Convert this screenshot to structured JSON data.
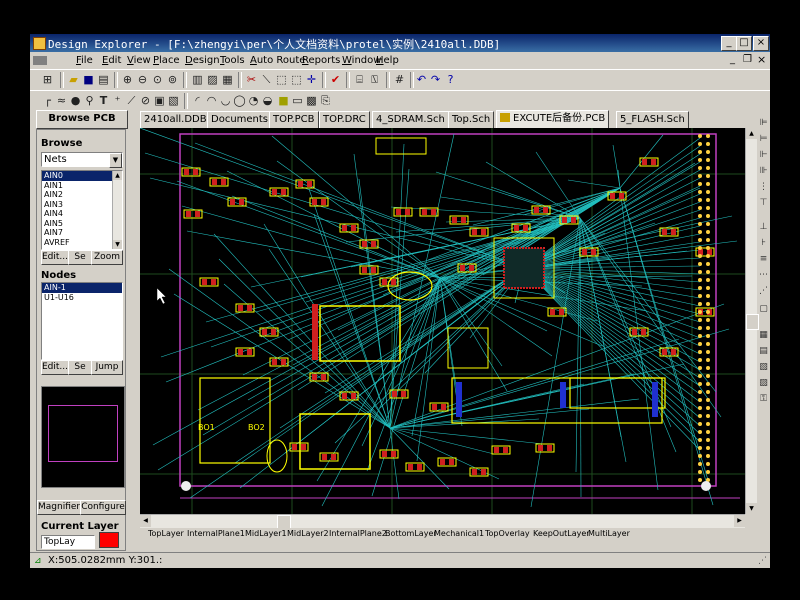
{
  "window": {
    "title": "Design Explorer - [F:\\zhengyi\\per\\个人文档资料\\protel\\实例\\2410all.DDB]",
    "controls": {
      "minimize": "_",
      "maximize": "□",
      "close": "×"
    }
  },
  "menubar": [
    "File",
    "Edit",
    "View",
    "Place",
    "Design",
    "Tools",
    "Auto Route",
    "Reports",
    "Window",
    "Help"
  ],
  "panel": {
    "tab": "Browse PCB",
    "browse_label": "Browse",
    "browse_select": "Nets",
    "nets": [
      "AIN0",
      "AIN1",
      "AIN2",
      "AIN3",
      "AIN4",
      "AIN5",
      "AIN7",
      "AVREF"
    ],
    "nets_selected": "AIN0",
    "net_buttons": [
      "Edit...",
      "Se",
      "Zoom"
    ],
    "nodes_label": "Nodes",
    "nodes": [
      "AIN-1",
      "U1-U16"
    ],
    "nodes_selected": "AIN-1",
    "node_buttons": [
      "Edit...",
      "Se",
      "Jump"
    ],
    "magnifier": "Magnifier",
    "configure": "Configure",
    "current_layer_label": "Current Layer",
    "current_layer": "TopLay",
    "current_layer_color": "#ff0000"
  },
  "doc_tabs": [
    "2410all.DDB",
    "Documents",
    "TOP.PCB",
    "TOP.DRC",
    "4_SDRAM.Sch",
    "Top.Sch",
    "EXCUTE后备份.PCB",
    "5_FLASH.Sch"
  ],
  "active_doc_tab": "EXCUTE后备份.PCB",
  "layer_tabs": [
    "TopLayer",
    "InternalPlane1",
    "MidLayer1",
    "MidLayer2",
    "InternalPlane2",
    "BottomLayer",
    "Mechanical1",
    "TopOverlay",
    "KeepOutLayer",
    "MultiLayer"
  ],
  "pcb_labels": [
    "BO1",
    "BO2"
  ],
  "status": {
    "coord": "X:505.0282mm Y:301.:"
  },
  "colors": {
    "titlebar": "#0a246a",
    "ratsnest": "#22c0c0",
    "overlay": "#ffff00",
    "top_layer": "#ff0000",
    "bottom_layer": "#0000ff",
    "board_edge": "#ff00ff"
  }
}
